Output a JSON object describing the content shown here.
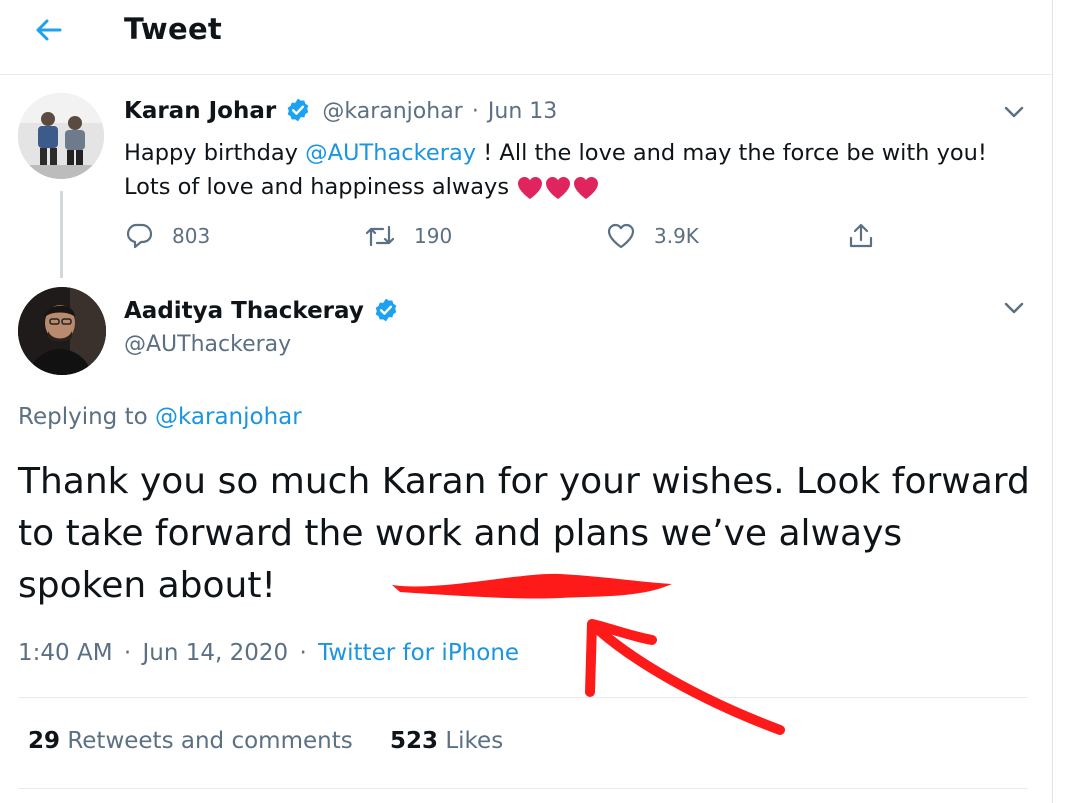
{
  "header": {
    "title": "Tweet"
  },
  "parent_tweet": {
    "name": "Karan Johar",
    "handle": "@karanjohar",
    "separator": "·",
    "date": "Jun 13",
    "text_before": "Happy birthday ",
    "mention": "@AUThackeray",
    "text_after": " ! All the love and may the force be with you!",
    "line2": "Lots of love and happiness always ",
    "replies": "803",
    "retweets": "190",
    "likes": "3.9K"
  },
  "main_tweet": {
    "name": "Aaditya Thackeray",
    "handle": "@AUThackeray",
    "replying_label": "Replying to ",
    "replying_to": "@karanjohar",
    "text": "Thank you so much Karan for your wishes. Look forward to take forward the work and plans we’ve always spoken about!",
    "time": "1:40 AM",
    "separator": "·",
    "date": "Jun 14, 2020",
    "source": "Twitter for iPhone"
  },
  "stats": {
    "retweets_count": "29",
    "retweets_label": " Retweets and comments",
    "likes_count": "523",
    "likes_label": " Likes"
  },
  "colors": {
    "accent": "#1da1f2",
    "annotation": "#ff1a1a",
    "heart": "#e0245e"
  },
  "icons": [
    "back-arrow-icon",
    "verified-icon",
    "chevron-down-icon",
    "reply-icon",
    "retweet-icon",
    "like-icon",
    "share-icon",
    "heart-emoji-icon"
  ]
}
